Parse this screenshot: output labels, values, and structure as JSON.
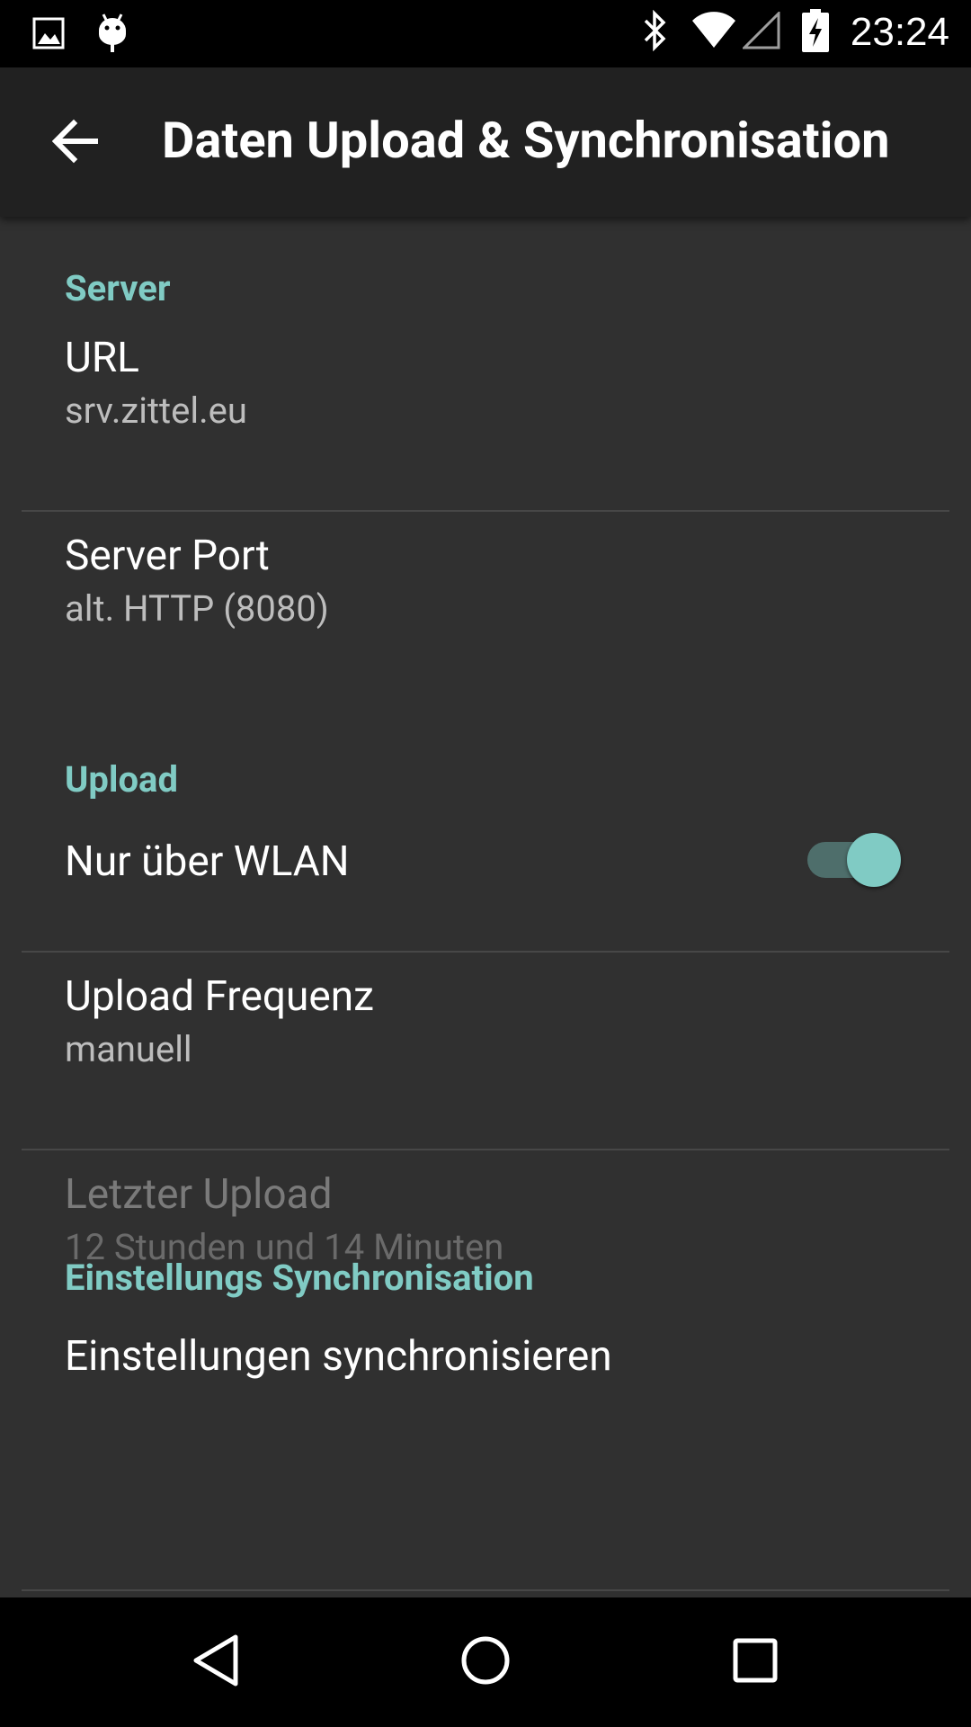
{
  "status_bar": {
    "time": "23:24",
    "left_icons": [
      "image-notification-icon",
      "android-debug-icon"
    ],
    "right_icons": [
      "bluetooth-icon",
      "wifi-icon",
      "cell-signal-icon",
      "battery-charging-icon"
    ]
  },
  "toolbar": {
    "title": "Daten Upload & Synchronisation",
    "back_icon": "arrow-back-icon"
  },
  "sections": [
    {
      "header": "Server",
      "items": [
        {
          "title": "URL",
          "summary": "srv.zittel.eu"
        },
        {
          "title": "Server Port",
          "summary": "alt. HTTP (8080)"
        }
      ]
    },
    {
      "header": "Upload",
      "items": [
        {
          "title": "Nur über WLAN",
          "switch_on": true
        },
        {
          "title": "Upload Frequenz",
          "summary": "manuell"
        },
        {
          "title": "Letzter Upload",
          "summary": "12 Stunden und 14 Minuten",
          "enabled": false
        }
      ]
    },
    {
      "header": "Einstellungs Synchronisation",
      "items": [
        {
          "title": "Einstellungen synchronisieren"
        }
      ]
    }
  ],
  "colors": {
    "accent": "#80cbc4",
    "background": "#303030",
    "toolbar": "#212121"
  },
  "nav_bar": {
    "buttons": [
      "back-triangle-icon",
      "home-circle-icon",
      "recents-square-icon"
    ]
  }
}
